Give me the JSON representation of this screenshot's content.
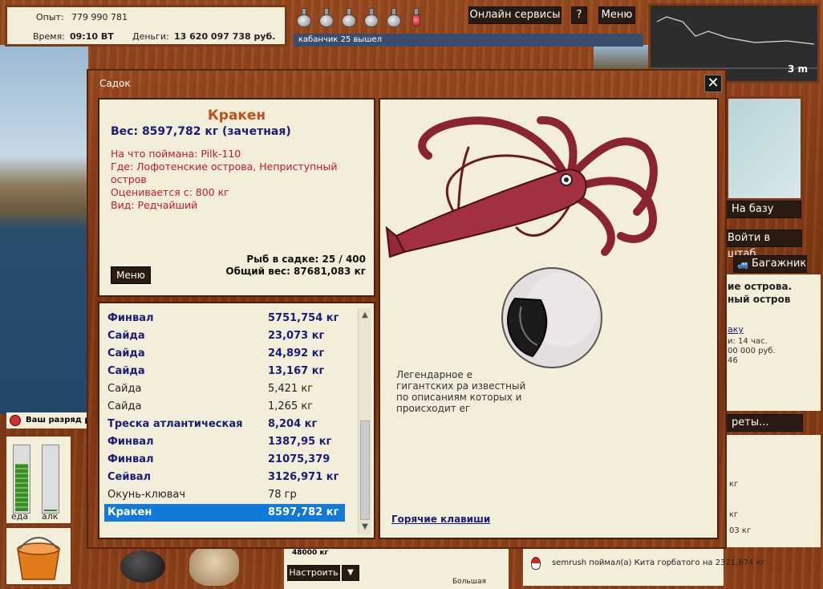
{
  "hud": {
    "exp_label": "Опыт:",
    "exp_value": "779 990 781",
    "time_label": "Время:",
    "time_value": "09:10 ВТ",
    "money_label": "Деньги:",
    "money_value": "13 620 097 738 руб."
  },
  "top_buttons": {
    "online": "Онлайн сервисы",
    "help": "?",
    "menu": "Меню"
  },
  "chat_line": "кабанчик 25 вышел",
  "minimap": {
    "depth": "3 m"
  },
  "right_panel": {
    "to_base": "На базу",
    "to_hq": "Войти в штаб",
    "trunk": "Багажник",
    "location_line1": "ие острова.",
    "location_line2": "ный остров",
    "link": "аку",
    "line_time": "и: 14 час.",
    "line_price": "00 000 руб.",
    "line_num": "46",
    "secrets_btn": "реты...",
    "log_lines": [
      "кг",
      "кг",
      "03 кг"
    ]
  },
  "rank_bar": "Ваш разряд р",
  "gauges": {
    "food_label": "еда",
    "alc_label": "алк",
    "food_level": 0.72,
    "alc_level": 0.02
  },
  "bottom": {
    "weight": "48000 кг",
    "setup": "Настроить",
    "setup_drop": "▼",
    "big": "Большая",
    "log": "semrush поймал(а) Кита горбатого на 2321,674 кг"
  },
  "dialog": {
    "title": "Садок",
    "close": "✕",
    "fish_name": "Кракен",
    "fish_weight": "Вес: 8597,782 кг (зачетная)",
    "details": [
      "На что поймана: Pilk-110",
      "Где: Лофотенские острова, Неприступный остров",
      "Оценивается с: 800 кг",
      "Вид: Редчайший"
    ],
    "count_line": "Рыб в садке: 25 / 400",
    "total_line": "Общий вес: 87681,083 кг",
    "menu_btn": "Меню",
    "fish_list": [
      {
        "name": "Финвал",
        "weight": "5751,754 кг",
        "rare": true
      },
      {
        "name": "Сайда",
        "weight": "23,073 кг",
        "rare": true
      },
      {
        "name": "Сайда",
        "weight": "24,892 кг",
        "rare": true
      },
      {
        "name": "Сайда",
        "weight": "13,167 кг",
        "rare": true
      },
      {
        "name": "Сайда",
        "weight": "5,421 кг",
        "rare": false
      },
      {
        "name": "Сайда",
        "weight": "1,265 кг",
        "rare": false
      },
      {
        "name": "Треска атлантическая",
        "weight": "8,204 кг",
        "rare": true
      },
      {
        "name": "Финвал",
        "weight": "1387,95 кг",
        "rare": true
      },
      {
        "name": "Финвал",
        "weight": "21075,379",
        "rare": true
      },
      {
        "name": "Сейвал",
        "weight": "3126,971 кг",
        "rare": true
      },
      {
        "name": "Окунь-клювач",
        "weight": "78 гр",
        "rare": false
      },
      {
        "name": "Кракен",
        "weight": "8597,782 кг",
        "rare": true,
        "selected": true
      }
    ],
    "description": [
      "Легендарное                                                        е",
      "гигантских ра                                             известный",
      "по описаниям                                             которых и",
      "происходит ег"
    ],
    "hotkeys": "Горячие клавиши"
  },
  "colors": {
    "wood": "#8e4118",
    "panel": "#f2eed9",
    "rare_text": "#1b1b7a",
    "detail_text": "#c4182b",
    "name_text": "#c0501a",
    "selected": "#1279d6"
  }
}
